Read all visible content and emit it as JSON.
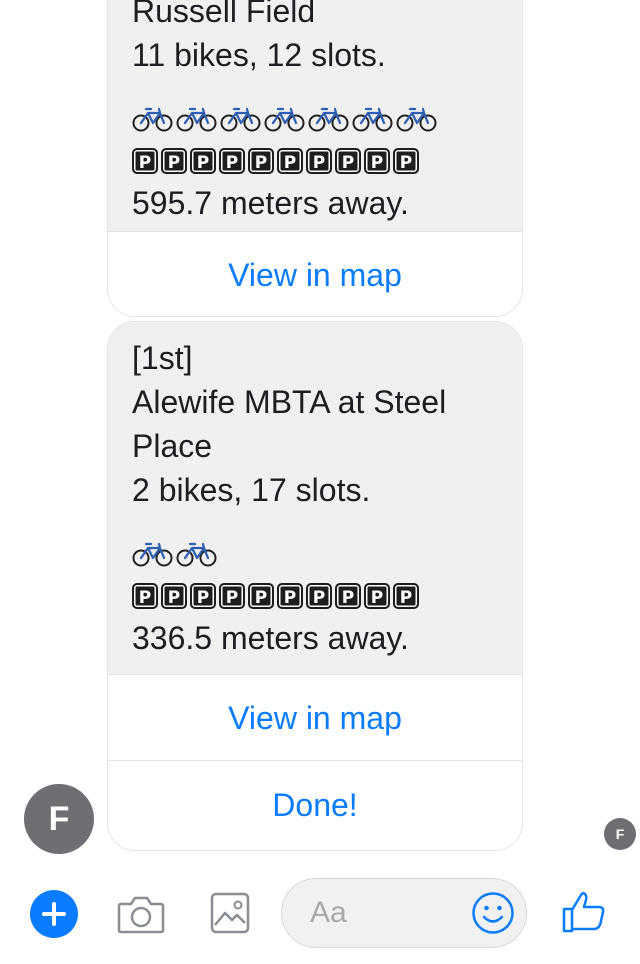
{
  "cards": [
    {
      "title_lines": [
        "Russell Field"
      ],
      "availability": "11 bikes, 12 slots.",
      "bike_count": 7,
      "slot_count": 10,
      "parking_glyph": "P",
      "distance": "595.7 meters away.",
      "buttons": [
        "View in map"
      ]
    },
    {
      "rank": "[1st]",
      "title": "Alewife MBTA at Steel Place",
      "availability": "2 bikes, 17 slots.",
      "bike_count": 2,
      "slot_count": 10,
      "parking_glyph": "P",
      "distance": "336.5 meters away.",
      "buttons": [
        "View in map",
        "Done!"
      ]
    }
  ],
  "avatar": {
    "letter": "F"
  },
  "read_receipt": {
    "letter": "F"
  },
  "composer": {
    "placeholder": "Aa",
    "icons": [
      "plus-icon",
      "camera-icon",
      "gallery-icon",
      "emoji-icon",
      "thumbs-up-icon"
    ]
  },
  "colors": {
    "accent": "#0a7cff",
    "bubble": "#f0f0f0",
    "avatar": "#6e6f73",
    "bike": "#2f5fb3"
  }
}
